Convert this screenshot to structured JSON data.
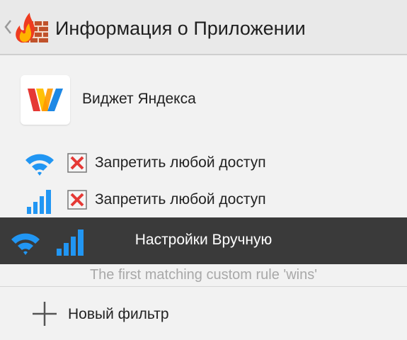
{
  "appbar": {
    "title": "Информация о Приложении",
    "back_icon": "chevron-left-icon",
    "logo_icon": "firewall-flame-icon"
  },
  "app": {
    "name": "Виджет Яндекса",
    "icon": "yandex-widget-icon"
  },
  "rules": [
    {
      "network": "wifi-icon",
      "state_icon": "deny-box-icon",
      "label": "Запретить любой доступ"
    },
    {
      "network": "cellular-signal-icon",
      "state_icon": "deny-box-icon",
      "label": "Запретить любой доступ"
    }
  ],
  "manual": {
    "label": "Настройки Вручную",
    "icons": [
      "wifi-icon",
      "cellular-signal-icon"
    ]
  },
  "hint": "The first matching custom rule 'wins'",
  "new_filter": {
    "label": "Новый фильтр",
    "icon": "plus-icon"
  },
  "colors": {
    "accent_blue": "#2196f3",
    "deny_red": "#e53935",
    "manual_bar": "#3a3a3a",
    "appbar": "#e9e9e9"
  }
}
